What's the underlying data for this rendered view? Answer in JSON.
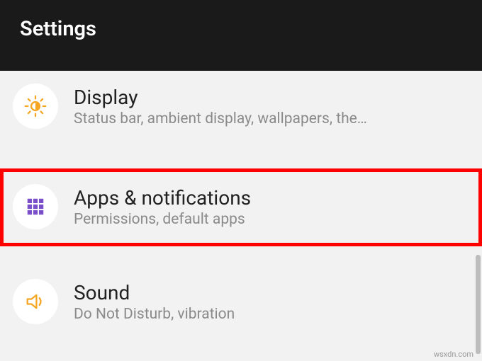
{
  "header": {
    "title": "Settings"
  },
  "items": [
    {
      "title": "Display",
      "subtitle": "Status bar, ambient display, wallpapers, the…",
      "icon": "brightness-icon",
      "color": "#f5a623"
    },
    {
      "title": "Apps & notifications",
      "subtitle": "Permissions, default apps",
      "icon": "apps-grid-icon",
      "color": "#7b4fc9"
    },
    {
      "title": "Sound",
      "subtitle": "Do Not Disturb, vibration",
      "icon": "speaker-icon",
      "color": "#f5a623"
    }
  ],
  "watermark": "wsxdn.com"
}
